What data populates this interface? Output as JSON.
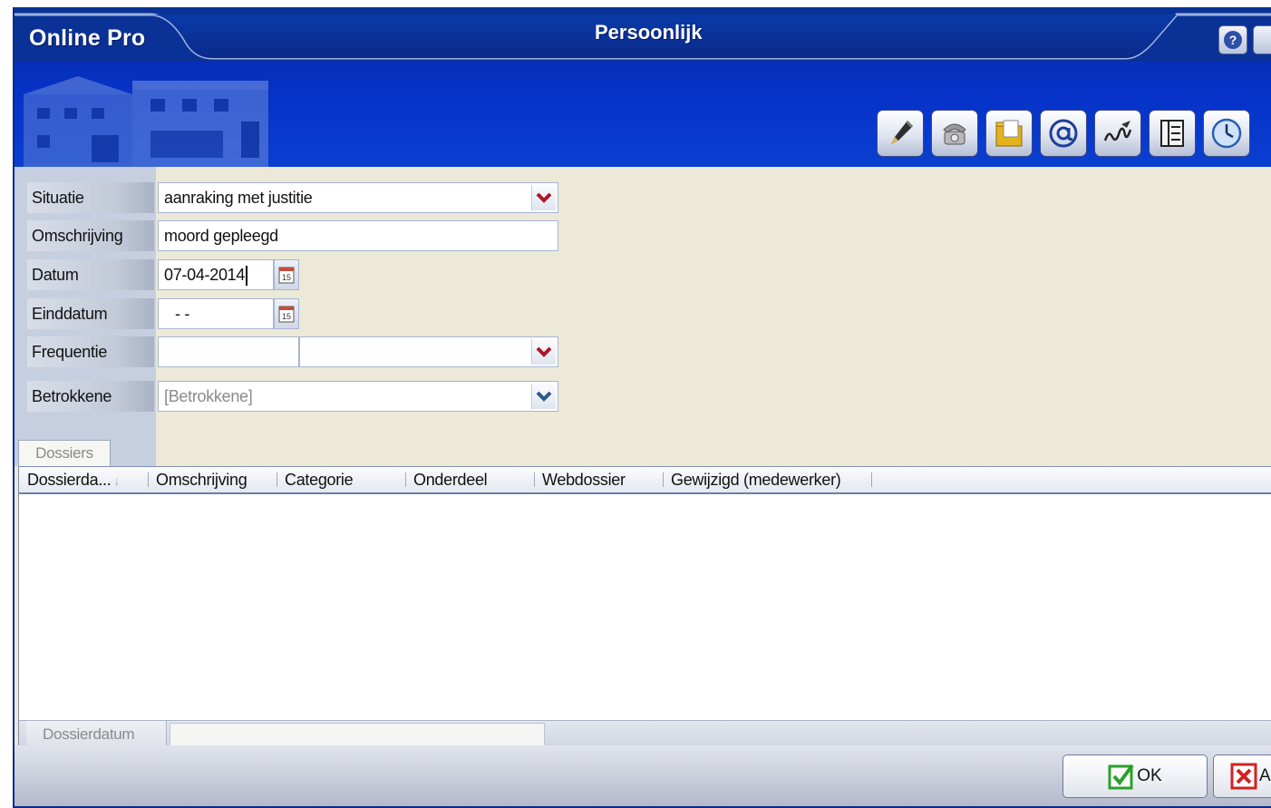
{
  "header": {
    "app_title": "Online Pro",
    "window_title": "Persoonlijk",
    "help_label": "?"
  },
  "toolbar": {
    "buttons": [
      "pen-icon",
      "phone-icon",
      "folder-icon",
      "email-icon",
      "signature-icon",
      "book-icon",
      "clock-icon"
    ]
  },
  "form": {
    "situatie": {
      "label": "Situatie",
      "value": "aanraking met justitie"
    },
    "omschrijving": {
      "label": "Omschrijving",
      "value": "moord gepleegd"
    },
    "datum": {
      "label": "Datum",
      "value": "07-04-2014"
    },
    "einddatum": {
      "label": "Einddatum",
      "value": "- -"
    },
    "frequentie": {
      "label": "Frequentie",
      "value": "",
      "unit": ""
    },
    "betrokkene": {
      "label": "Betrokkene",
      "placeholder": "[Betrokkene]"
    },
    "calendar_day": "15"
  },
  "tabs": [
    "Dossiers"
  ],
  "grid": {
    "columns": [
      "Dossierda...",
      "Omschrijving",
      "Categorie",
      "Onderdeel",
      "Webdossier",
      "Gewijzigd (medewerker)"
    ],
    "rows": [],
    "footer_label": "Dossierdatum",
    "footer_value": ""
  },
  "buttons": {
    "ok": "OK",
    "cancel": "A"
  },
  "colors": {
    "header_blue": "#0632c8",
    "form_bg": "#ece9d8",
    "ok_green": "#2aa02a",
    "cancel_red": "#d42020"
  }
}
